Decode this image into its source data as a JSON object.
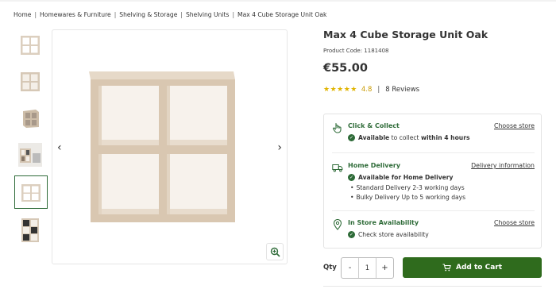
{
  "breadcrumb": [
    "Home",
    "Homewares & Furniture",
    "Shelving & Storage",
    "Shelving Units",
    "Max 4 Cube Storage Unit Oak"
  ],
  "breadcrumb_separator": "|",
  "product": {
    "title": "Max 4 Cube Storage Unit Oak",
    "code": "Product Code: 1181408",
    "price": "€55.00",
    "rating_stars": "★★★★★",
    "rating_value": "4.8",
    "rating_sep": "|",
    "reviews": "8 Reviews"
  },
  "gallery": {
    "thumb_count": 6,
    "active_thumb": 5,
    "prev_glyph": "‹",
    "next_glyph": "›"
  },
  "fulfilment": {
    "click_collect": {
      "title": "Click & Collect",
      "link": "Choose store",
      "line_bold": "Available",
      "line_mid": " to collect ",
      "line_bold2": "within 4 hours"
    },
    "home_delivery": {
      "title": "Home Delivery",
      "link": "Delivery information",
      "line1": "Available for Home Delivery",
      "line2": "Standard Delivery 2-3 working days",
      "line3": "Bulky Delivery Up to 5 working days"
    },
    "in_store": {
      "title": "In Store Availability",
      "link": "Choose store",
      "line1": "Check store availability"
    }
  },
  "purchase": {
    "qty_label": "Qty",
    "minus": "-",
    "qty_value": "1",
    "plus": "+",
    "add_to_cart": "Add to Cart"
  },
  "colors": {
    "brand_green": "#2e6b38",
    "button_green": "#2f6b1d",
    "star_gold": "#e0b400"
  }
}
